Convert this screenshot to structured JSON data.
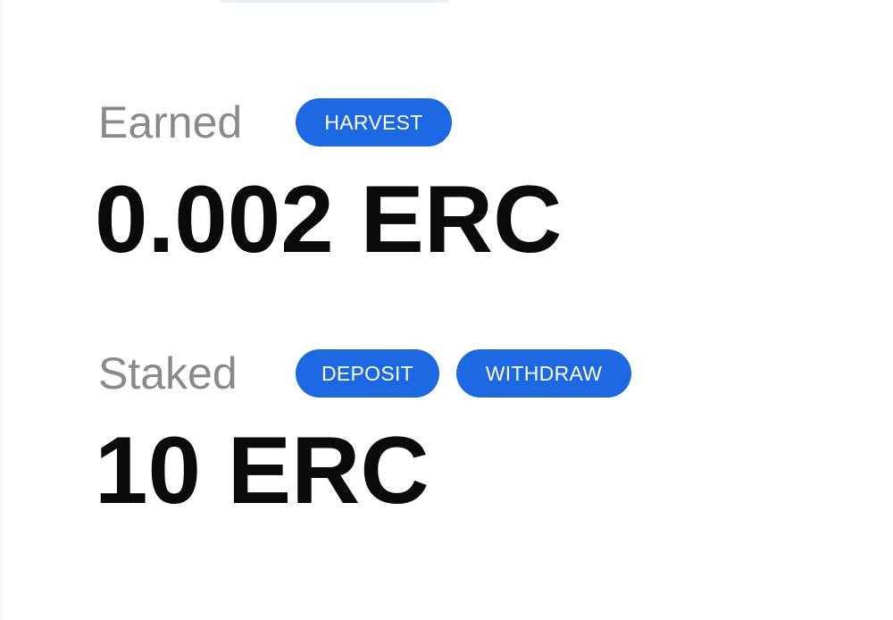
{
  "earned": {
    "label": "Earned",
    "harvest_button": "HARVEST",
    "amount": "0.002 ERC"
  },
  "staked": {
    "label": "Staked",
    "deposit_button": "DEPOSIT",
    "withdraw_button": "WITHDRAW",
    "amount": "10 ERC"
  },
  "colors": {
    "button_background": "#1c68e3",
    "button_text": "#ffffff",
    "label_text": "#8a8a8a",
    "amount_text": "#0a0a0a"
  }
}
